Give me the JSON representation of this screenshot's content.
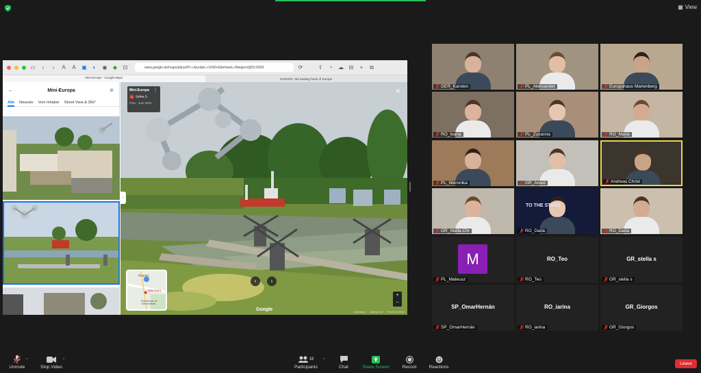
{
  "window": {
    "view_label": "View"
  },
  "browser": {
    "url": "www.google.de/maps/place/Pl.+Jourdan,+1040+Etterbeek,+Belgien/@50.8393",
    "tabs": [
      "Mini-Europe - Google Maps",
      "EUROPA: the beating heart of Europe"
    ]
  },
  "maps": {
    "panel_title": "Mini-Europa",
    "tabs": [
      "Alle",
      "Neueste",
      "Vom Inhaber",
      "Street View & 360°"
    ],
    "photo_card": {
      "place": "Mini-Europa",
      "author": "Selina S.",
      "date": "Foto - Juni 2021"
    },
    "map_labels": [
      "Bruparc",
      "Mini-Euro",
      "Planetarium de l'Observatoire"
    ],
    "brand": "Google",
    "footer": [
      "Impressum",
      "Datenschutz",
      "Problem melden"
    ]
  },
  "participants": [
    {
      "name": "GER_Karsten",
      "video": true
    },
    {
      "name": "PL_Aleksander",
      "video": true
    },
    {
      "name": "Europahaus Marienberg",
      "video": true
    },
    {
      "name": "RO_Ioana",
      "video": true
    },
    {
      "name": "PL_Zuzanna",
      "video": true
    },
    {
      "name": "RO_Maria",
      "video": true
    },
    {
      "name": "PL_Weronika",
      "video": true
    },
    {
      "name": "GR_Anast",
      "video": true
    },
    {
      "name": "Andreas Christ",
      "video": true,
      "active": true
    },
    {
      "name": "GR_Stella Chr",
      "video": true
    },
    {
      "name": "RO_Daria",
      "video": true,
      "banner": "TO THE STARS"
    },
    {
      "name": "RO_Daria",
      "video": true
    },
    {
      "name": "PL_Mateusz",
      "video": false,
      "avatar_letter": "M",
      "avatar_color": "#8a1fb5"
    },
    {
      "name": "RO_Teo",
      "video": false,
      "display": "RO_Teo"
    },
    {
      "name": "GR_stella s",
      "video": false,
      "display": "GR_stella s"
    },
    {
      "name": "SP_OmarHernán",
      "video": false,
      "display": "SP_OmarHernán"
    },
    {
      "name": "RO_iarina",
      "video": false,
      "display": "RO_iarina"
    },
    {
      "name": "GR_Giorgos",
      "video": false,
      "display": "GR_Giorgos"
    }
  ],
  "toolbar": {
    "unmute": "Unmute",
    "stop_video": "Stop Video",
    "participants": "Participants",
    "participants_count": "18",
    "chat": "Chat",
    "share_screen": "Share Screen",
    "record": "Record",
    "reactions": "Reactions",
    "leave": "Leave"
  },
  "colors": {
    "accent_green": "#25c05a",
    "leave_red": "#e02d2d",
    "active_speaker": "#e8d84a"
  }
}
